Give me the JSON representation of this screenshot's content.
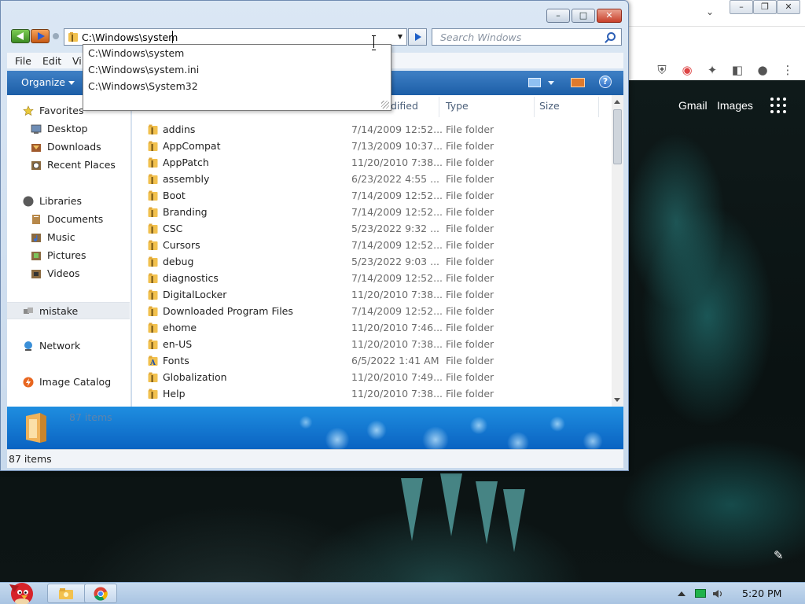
{
  "explorer": {
    "address": {
      "value": "C:\\Windows\\system",
      "suggestions": [
        "C:\\Windows\\system",
        "C:\\Windows\\system.ini",
        "C:\\Windows\\System32"
      ]
    },
    "search": {
      "placeholder": "Search Windows"
    },
    "menu": {
      "file": "File",
      "edit": "Edit",
      "view": "Vi"
    },
    "toolbar": {
      "organize": "Organize"
    },
    "nav": {
      "favorites": "Favorites",
      "desktop": "Desktop",
      "downloads": "Downloads",
      "recent_places": "Recent Places",
      "libraries": "Libraries",
      "documents": "Documents",
      "music": "Music",
      "pictures": "Pictures",
      "videos": "Videos",
      "mistake": "mistake",
      "network": "Network",
      "image_catalog": "Image Catalog"
    },
    "columns": {
      "modified": "dified",
      "type": "Type",
      "size": "Size"
    },
    "files": [
      {
        "name": "addins",
        "date": "7/14/2009 12:52...",
        "type": "File folder"
      },
      {
        "name": "AppCompat",
        "date": "7/13/2009 10:37...",
        "type": "File folder"
      },
      {
        "name": "AppPatch",
        "date": "11/20/2010 7:38...",
        "type": "File folder"
      },
      {
        "name": "assembly",
        "date": "6/23/2022 4:55 ...",
        "type": "File folder"
      },
      {
        "name": "Boot",
        "date": "7/14/2009 12:52...",
        "type": "File folder"
      },
      {
        "name": "Branding",
        "date": "7/14/2009 12:52...",
        "type": "File folder"
      },
      {
        "name": "CSC",
        "date": "5/23/2022 9:32 ...",
        "type": "File folder"
      },
      {
        "name": "Cursors",
        "date": "7/14/2009 12:52...",
        "type": "File folder"
      },
      {
        "name": "debug",
        "date": "5/23/2022 9:03 ...",
        "type": "File folder"
      },
      {
        "name": "diagnostics",
        "date": "7/14/2009 12:52...",
        "type": "File folder"
      },
      {
        "name": "DigitalLocker",
        "date": "11/20/2010 7:38...",
        "type": "File folder"
      },
      {
        "name": "Downloaded Program Files",
        "date": "7/14/2009 12:52...",
        "type": "File folder"
      },
      {
        "name": "ehome",
        "date": "11/20/2010 7:46...",
        "type": "File folder"
      },
      {
        "name": "en-US",
        "date": "11/20/2010 7:38...",
        "type": "File folder"
      },
      {
        "name": "Fonts",
        "date": "6/5/2022 1:41 AM",
        "type": "File folder"
      },
      {
        "name": "Globalization",
        "date": "11/20/2010 7:49...",
        "type": "File folder"
      },
      {
        "name": "Help",
        "date": "11/20/2010 7:38...",
        "type": "File folder"
      }
    ],
    "details": {
      "count": "87 items"
    },
    "status": {
      "text": "87 items"
    }
  },
  "chrome": {
    "gmail": "Gmail",
    "images": "Images"
  },
  "taskbar": {
    "clock": "5:20 PM"
  },
  "colors": {
    "command_bar": "#1c5ea7",
    "details_pane": "#0a63c2",
    "folder_yellow": "#f2c14e",
    "taskbar": "#a9c4e2"
  }
}
